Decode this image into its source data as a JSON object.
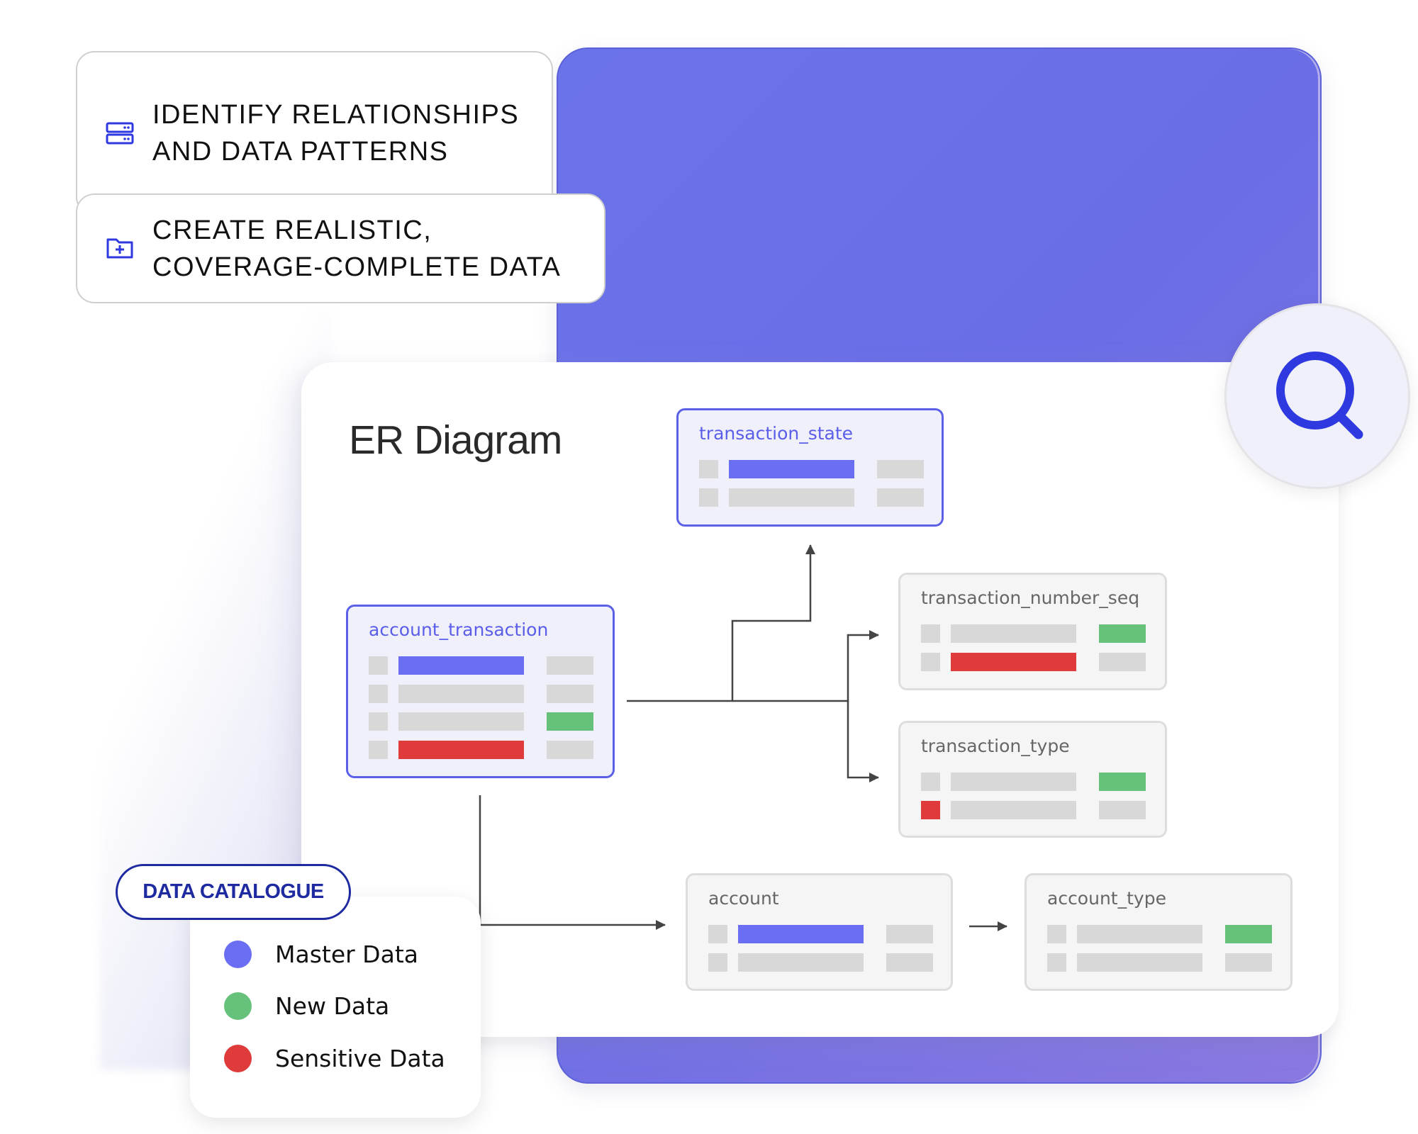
{
  "features": [
    {
      "icon": "server-icon",
      "label": "IDENTIFY RELATIONSHIPS\nAND DATA PATTERNS"
    },
    {
      "icon": "folder-plus-icon",
      "label": "CREATE REALISTIC,\nCOVERAGE-COMPLETE DATA"
    }
  ],
  "er_diagram": {
    "title": "ER Diagram",
    "entities": [
      {
        "id": "transaction_state",
        "name": "transaction_state",
        "style": "primary",
        "rows": [
          [
            "empty",
            "master",
            "empty"
          ],
          [
            "empty",
            "empty",
            "empty"
          ]
        ]
      },
      {
        "id": "account_transaction",
        "name": "account_transaction",
        "style": "primary",
        "rows": [
          [
            "empty",
            "master",
            "empty"
          ],
          [
            "empty",
            "empty",
            "empty"
          ],
          [
            "empty",
            "empty",
            "new"
          ],
          [
            "empty",
            "sensitive",
            "empty"
          ]
        ]
      },
      {
        "id": "transaction_number_seq",
        "name": "transaction_number_seq",
        "style": "secondary",
        "rows": [
          [
            "empty",
            "empty",
            "new"
          ],
          [
            "empty",
            "sensitive",
            "empty"
          ]
        ]
      },
      {
        "id": "transaction_type",
        "name": "transaction_type",
        "style": "secondary",
        "rows": [
          [
            "empty",
            "empty",
            "new"
          ],
          [
            "sensitive",
            "empty",
            "empty"
          ]
        ]
      },
      {
        "id": "account",
        "name": "account",
        "style": "secondary",
        "rows": [
          [
            "empty",
            "master",
            "empty"
          ],
          [
            "empty",
            "empty",
            "empty"
          ]
        ]
      },
      {
        "id": "account_type",
        "name": "account_type",
        "style": "secondary",
        "rows": [
          [
            "empty",
            "empty",
            "new"
          ],
          [
            "empty",
            "empty",
            "empty"
          ]
        ]
      }
    ],
    "relationships": [
      {
        "from": "account_transaction",
        "to": "transaction_state"
      },
      {
        "from": "account_transaction",
        "to": "transaction_number_seq"
      },
      {
        "from": "account_transaction",
        "to": "transaction_type"
      },
      {
        "from": "account_transaction",
        "to": "account"
      },
      {
        "from": "account",
        "to": "account_type"
      }
    ]
  },
  "search_button": {
    "icon": "search-icon"
  },
  "data_catalogue": {
    "title": "DATA CATALOGUE",
    "legend": [
      {
        "key": "master",
        "label": "Master Data",
        "color": "#6a6ef2"
      },
      {
        "key": "new",
        "label": "New Data",
        "color": "#66c17a"
      },
      {
        "key": "sensitive",
        "label": "Sensitive Data",
        "color": "#e03b3b"
      }
    ]
  },
  "colors": {
    "accent": "#5a5ee8",
    "icon_blue": "#2f39e0",
    "catalogue_navy": "#1e2aa0",
    "panel_purple": "#6b73ea"
  }
}
